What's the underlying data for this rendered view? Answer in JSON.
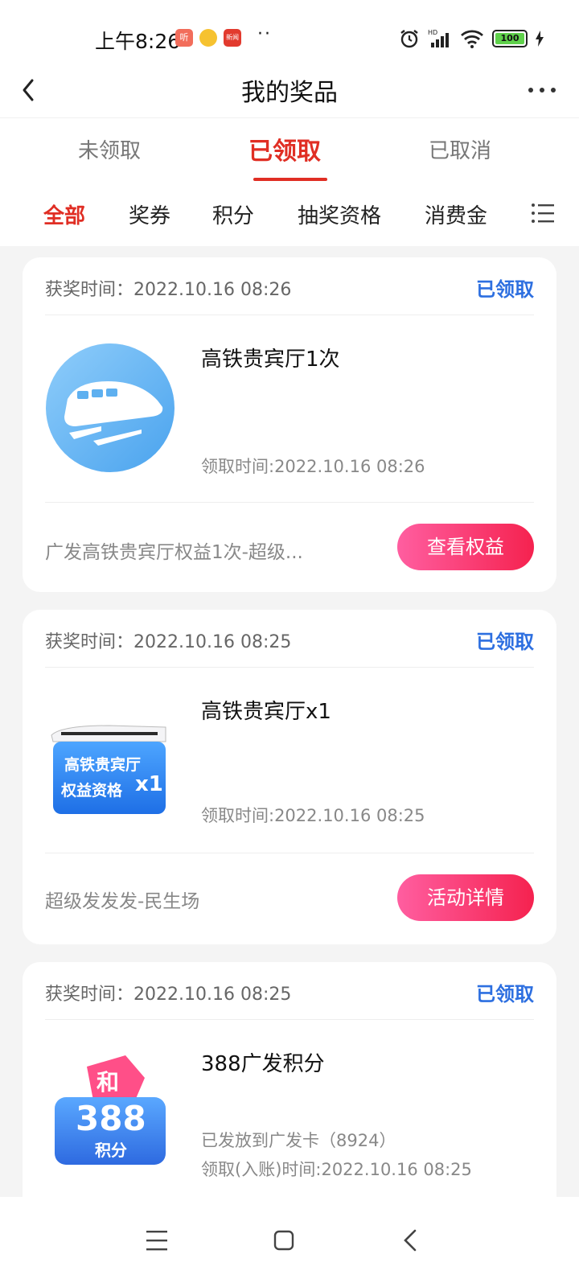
{
  "status_bar": {
    "time": "上午8:26",
    "notif_icons": [
      "听",
      "",
      "新闻"
    ],
    "battery": "100",
    "network": "HD"
  },
  "header": {
    "title": "我的奖品"
  },
  "tabs": [
    {
      "label": "未领取",
      "active": false
    },
    {
      "label": "已领取",
      "active": true
    },
    {
      "label": "已取消",
      "active": false
    }
  ],
  "filters": [
    {
      "label": "全部",
      "active": true
    },
    {
      "label": "奖券",
      "active": false
    },
    {
      "label": "积分",
      "active": false
    },
    {
      "label": "抽奖资格",
      "active": false
    },
    {
      "label": "消费金",
      "active": false
    }
  ],
  "cards": [
    {
      "award_time": "获奖时间：2022.10.16 08:26",
      "status": "已领取",
      "title": "高铁贵宾厅1次",
      "sub_lines": [
        "领取时间:2022.10.16 08:26"
      ],
      "footer_desc": "广发高铁贵宾厅权益1次-超级...",
      "button": "查看权益",
      "image": "train-icon"
    },
    {
      "award_time": "获奖时间：2022.10.16 08:25",
      "status": "已领取",
      "title": "高铁贵宾厅x1",
      "sub_lines": [
        "领取时间:2022.10.16 08:25"
      ],
      "footer_desc": "超级发发发-民生场",
      "button": "活动详情",
      "image": "lounge-voucher-image",
      "image_text": {
        "line1": "高铁贵宾厅",
        "line2": "权益资格",
        "count": "x1"
      }
    },
    {
      "award_time": "获奖时间：2022.10.16 08:25",
      "status": "已领取",
      "title": "388广发积分",
      "sub_lines": [
        "已发放到广发卡（8924）",
        "领取(入账)时间:2022.10.16 08:25"
      ],
      "image": "points-image",
      "image_text": {
        "tag": "和",
        "number": "388",
        "unit": "积分"
      }
    }
  ],
  "colors": {
    "accent_red": "#e02e24",
    "status_blue": "#2d6fe0",
    "button_gradient_start": "#ff5ea0",
    "button_gradient_end": "#f5224f"
  }
}
